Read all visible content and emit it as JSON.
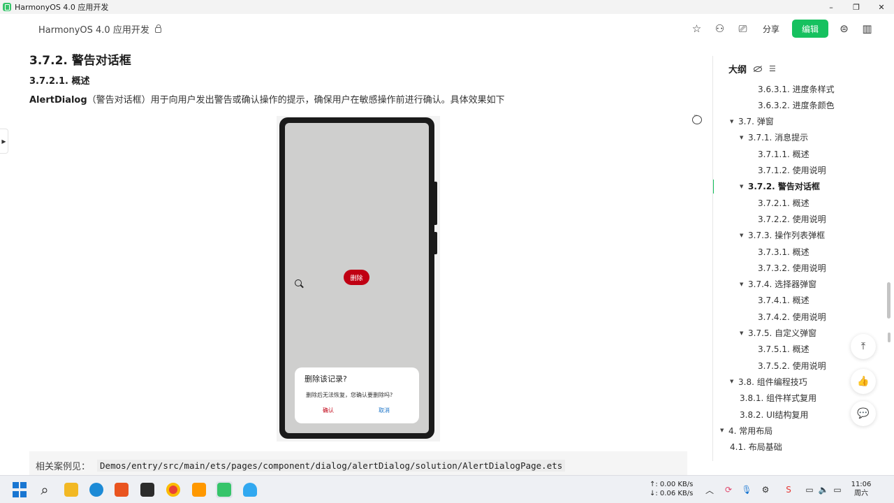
{
  "window": {
    "title": "HarmonyOS 4.0 应用开发",
    "controls": [
      "–",
      "❐",
      "✕"
    ]
  },
  "header": {
    "doc_title": "HarmonyOS 4.0 应用开发",
    "share_label": "分享",
    "edit_label": "编辑"
  },
  "content": {
    "heading": "3.7.2. 警告对话框",
    "subheading": "3.7.2.1. 概述",
    "para_bold": "AlertDialog",
    "para_rest": "（警告对话框）用于向用户发出警告或确认操作的提示，确保用户在敏感操作前进行确认。具体效果如下",
    "phone": {
      "delete_button": "删除",
      "dialog_title": "删除该记录?",
      "dialog_message": "删除后无法恢复，您确认要删除吗?",
      "confirm_label": "确认",
      "cancel_label": "取消",
      "accent_color": "#c00013"
    },
    "code_ref_label": "相关案例见：",
    "code_ref_path": "Demos/entry/src/main/ets/pages/component/dialog/alertDialog/solution/AlertDialogPage.ets"
  },
  "outline": {
    "title": "大纲",
    "items": [
      {
        "label": "3.6.3.1. 进度条样式",
        "level": 4,
        "caret": false
      },
      {
        "label": "3.6.3.2. 进度条颜色",
        "level": 4,
        "caret": false
      },
      {
        "label": "3.7. 弹窗",
        "level": 2,
        "caret": true
      },
      {
        "label": "3.7.1. 消息提示",
        "level": 3,
        "caret": true
      },
      {
        "label": "3.7.1.1. 概述",
        "level": 4,
        "caret": false
      },
      {
        "label": "3.7.1.2. 使用说明",
        "level": 4,
        "caret": false
      },
      {
        "label": "3.7.2. 警告对话框",
        "level": 3,
        "caret": true,
        "active": true
      },
      {
        "label": "3.7.2.1. 概述",
        "level": 4,
        "caret": false
      },
      {
        "label": "3.7.2.2. 使用说明",
        "level": 4,
        "caret": false
      },
      {
        "label": "3.7.3. 操作列表弹框",
        "level": 3,
        "caret": true
      },
      {
        "label": "3.7.3.1. 概述",
        "level": 4,
        "caret": false
      },
      {
        "label": "3.7.3.2. 使用说明",
        "level": 4,
        "caret": false
      },
      {
        "label": "3.7.4. 选择器弹窗",
        "level": 3,
        "caret": true
      },
      {
        "label": "3.7.4.1. 概述",
        "level": 4,
        "caret": false
      },
      {
        "label": "3.7.4.2. 使用说明",
        "level": 4,
        "caret": false
      },
      {
        "label": "3.7.5. 自定义弹窗",
        "level": 3,
        "caret": true
      },
      {
        "label": "3.7.5.1. 概述",
        "level": 4,
        "caret": false
      },
      {
        "label": "3.7.5.2. 使用说明",
        "level": 4,
        "caret": false
      },
      {
        "label": "3.8. 组件编程技巧",
        "level": 2,
        "caret": true
      },
      {
        "label": "3.8.1. 组件样式复用",
        "level": 3,
        "caret": false
      },
      {
        "label": "3.8.2. UI结构复用",
        "level": 3,
        "caret": false
      },
      {
        "label": "4. 常用布局",
        "level": 1,
        "caret": true
      },
      {
        "label": "4.1. 布局基础",
        "level": 2,
        "caret": false
      }
    ]
  },
  "taskbar": {
    "net_up": "↑: 0.00 KB/s",
    "net_down": "↓: 0.06 KB/s",
    "time": "11:06",
    "day": "周六"
  },
  "colors": {
    "brand_green": "#16c15f",
    "danger_red": "#c00013",
    "link_blue": "#1a73c8"
  }
}
